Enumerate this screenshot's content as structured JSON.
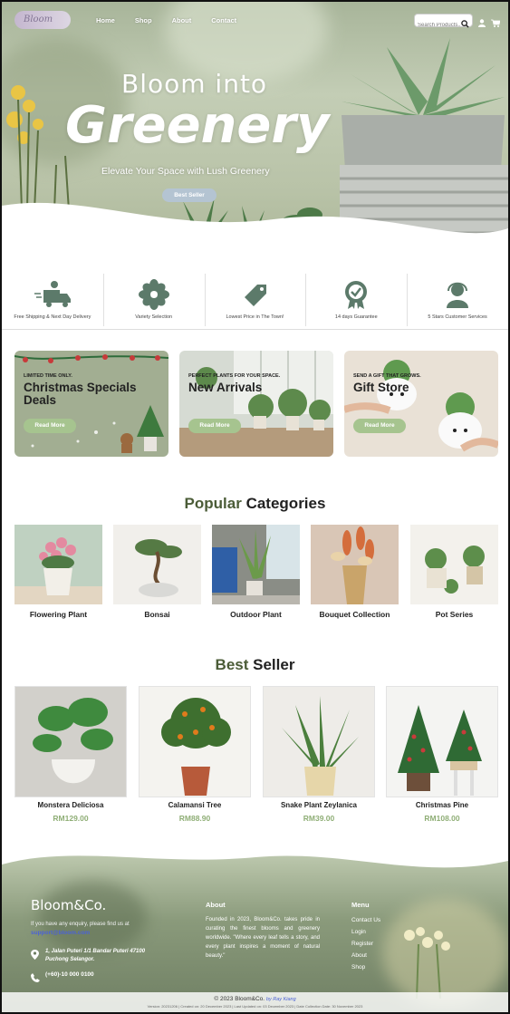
{
  "colors": {
    "accent_green": "#4b5c37",
    "price_green": "#8fae76",
    "button_green": "#a6c48f",
    "hero_button": "#b4c4d2",
    "email_blue": "#4b62d6"
  },
  "header": {
    "logo_text": "Bloom",
    "nav": [
      "Home",
      "Shop",
      "About",
      "Contact"
    ],
    "search_placeholder": "Search Products...",
    "icons": [
      "search-icon",
      "user-icon",
      "cart-icon"
    ]
  },
  "hero": {
    "title_line1": "Bloom into",
    "title_line2": "Greenery",
    "subtitle": "Elevate Your Space with Lush Greenery",
    "button": "Best Seller"
  },
  "features": [
    {
      "icon": "delivery-truck-icon",
      "label": "Free Shipping & Next Day Delivery"
    },
    {
      "icon": "flower-icon",
      "label": "Variety Selection"
    },
    {
      "icon": "price-tag-icon",
      "label": "Lowest Price in The Town!"
    },
    {
      "icon": "guarantee-badge-icon",
      "label": "14 days Guarantee"
    },
    {
      "icon": "customer-service-icon",
      "label": "5 Stars Customer Services"
    }
  ],
  "promos": [
    {
      "tag": "LIMITED TIME ONLY.",
      "title": "Christmas Specials Deals",
      "button": "Read More"
    },
    {
      "tag": "PERFECT PLANTS FOR YOUR SPACE.",
      "title": "New Arrivals",
      "button": "Read More"
    },
    {
      "tag": "SEND A GIFT THAT GROWS.",
      "title": "Gift Store",
      "button": "Read More"
    }
  ],
  "categories": {
    "title_accent": "Popular",
    "title_rest": "Categories",
    "items": [
      "Flowering Plant",
      "Bonsai",
      "Outdoor Plant",
      "Bouquet Collection",
      "Pot Series"
    ]
  },
  "best_seller": {
    "title_accent": "Best",
    "title_rest": "Seller",
    "items": [
      {
        "name": "Monstera Deliciosa",
        "price": "RM129.00"
      },
      {
        "name": "Calamansi Tree",
        "price": "RM88.90"
      },
      {
        "name": "Snake Plant Zeylanica",
        "price": "RM39.00"
      },
      {
        "name": "Christmas Pine",
        "price": "RM108.00"
      }
    ]
  },
  "footer": {
    "brand": "Bloom&Co.",
    "enquiry": "If you have any enquiry, please find us at",
    "email": "support@bloom.com",
    "address": "1, Jalan Puteri 1/1 Bandar Puteri 47100 Puchong Selangor.",
    "phone": "(+60)-10 000 0100",
    "about_heading": "About",
    "about_text": "Founded in 2023, Bloom&Co. takes pride in curating the finest blooms and greenery worldwide. \"Where every leaf tells a story, and every plant inspires a moment of natural beauty.\"",
    "menu_heading": "Menu",
    "menu": [
      "Contact Us",
      "Login",
      "Register",
      "About",
      "Shop"
    ],
    "copyright": "© 2023 Bloom&Co.",
    "credit": "by Ray Kiang",
    "version": "Version: 20231206 | Created on: 20 December 2023 | Last Updated on: 03 December 2023 | Date Collection Date: 30 November 2023"
  }
}
